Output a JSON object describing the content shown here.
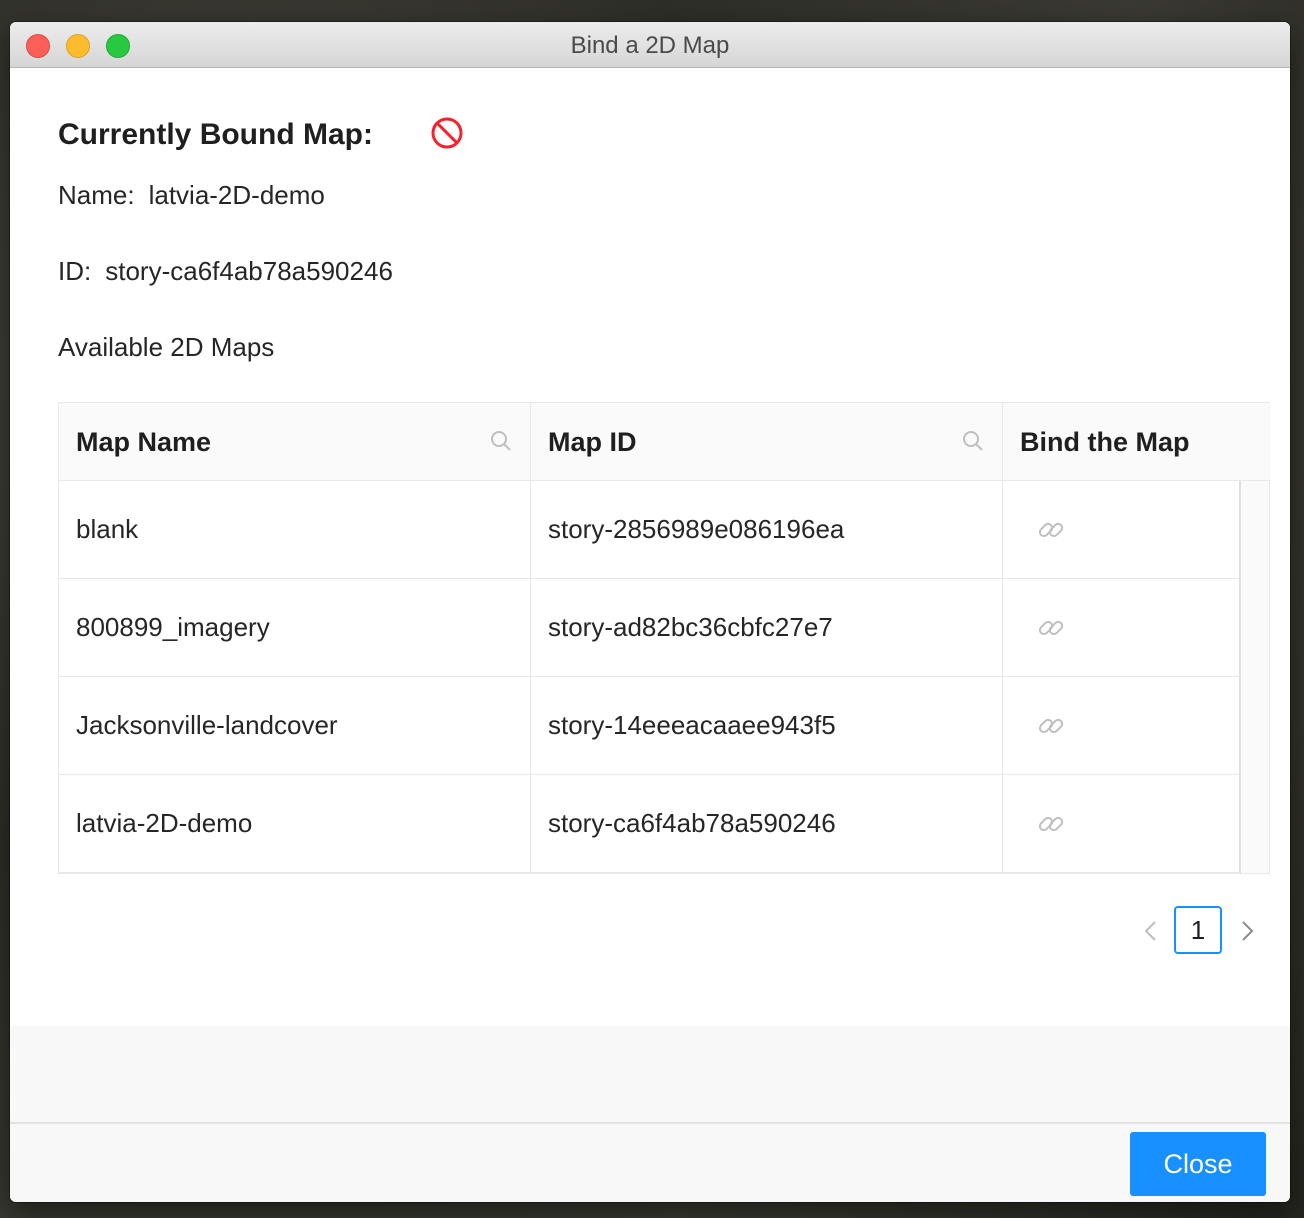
{
  "window": {
    "title": "Bind a 2D Map"
  },
  "bound_map": {
    "heading": "Currently Bound Map:",
    "status_icon": "ban-icon",
    "name_label": "Name:",
    "name_value": "latvia-2D-demo",
    "id_label": "ID:",
    "id_value": "story-ca6f4ab78a590246"
  },
  "available": {
    "heading": "Available 2D Maps",
    "columns": [
      "Map Name",
      "Map ID",
      "Bind the Map"
    ],
    "rows": [
      {
        "name": "blank",
        "id": "story-2856989e086196ea",
        "bind_icon": "link-icon"
      },
      {
        "name": "800899_imagery",
        "id": "story-ad82bc36cbfc27e7",
        "bind_icon": "link-icon"
      },
      {
        "name": "Jacksonville-landcover",
        "id": "story-14eeeacaaee943f5",
        "bind_icon": "link-icon"
      },
      {
        "name": "latvia-2D-demo",
        "id": "story-ca6f4ab78a590246",
        "bind_icon": "link-icon"
      }
    ]
  },
  "pagination": {
    "current_page": "1"
  },
  "footer": {
    "close_label": "Close"
  },
  "colors": {
    "accent": "#1890ff",
    "danger": "#f5222d"
  }
}
